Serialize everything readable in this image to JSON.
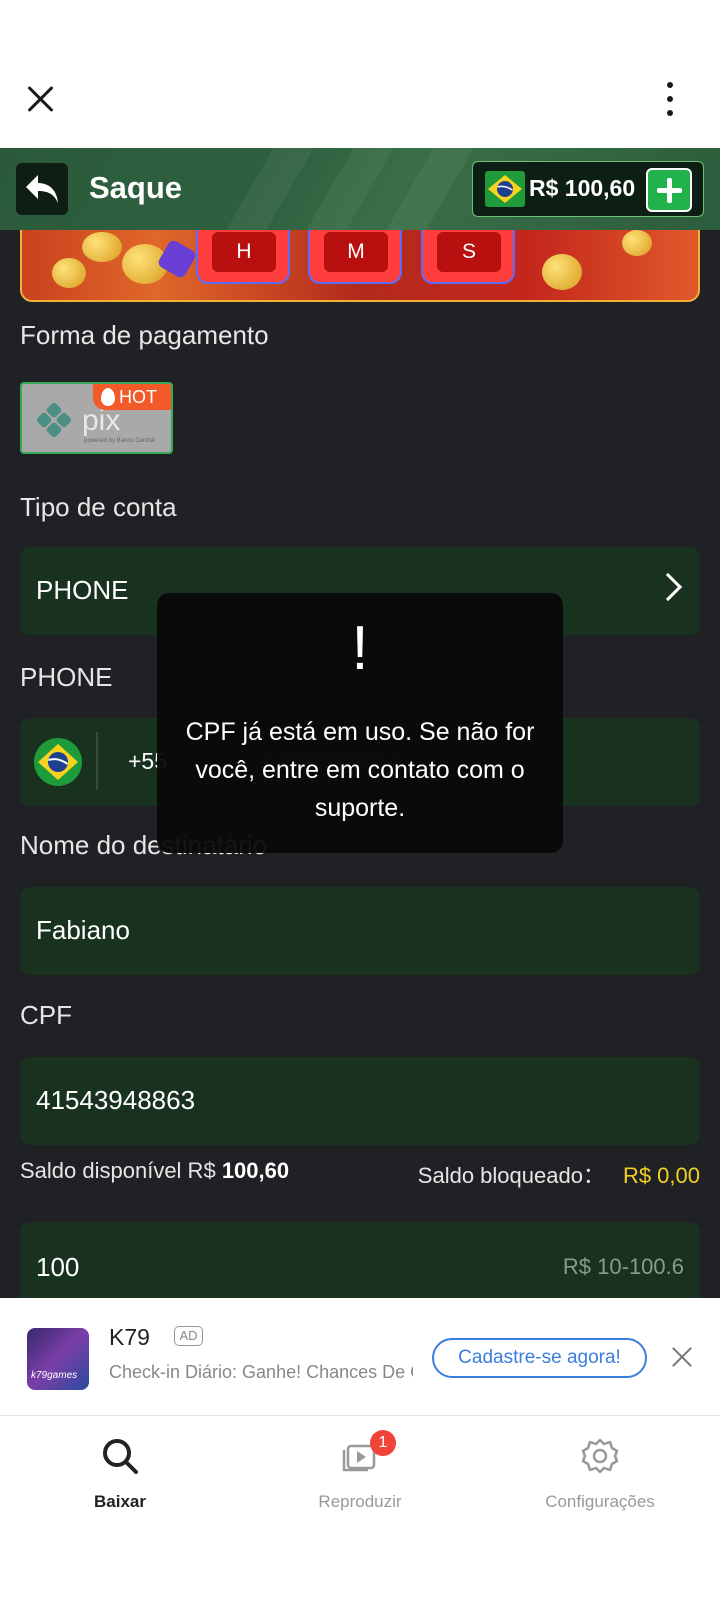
{
  "header": {
    "title": "Saque",
    "balance": "R$ 100,60"
  },
  "banner": {
    "timer_labels": [
      "H",
      "M",
      "S"
    ]
  },
  "payment": {
    "label": "Forma de pagamento",
    "method_logo": "PIX",
    "badge": "HOT"
  },
  "account_type": {
    "label": "Tipo de conta",
    "value": "PHONE"
  },
  "phone": {
    "label": "PHONE",
    "prefix": "+55",
    "value": "17997769644"
  },
  "recipient": {
    "label": "Nome do destinatário",
    "value": "Fabiano"
  },
  "cpf": {
    "label": "CPF",
    "value": "41543948863"
  },
  "saldo": {
    "available_label": "Saldo disponível R$",
    "available_value": "100,60",
    "blocked_label": "Saldo bloqueado：",
    "blocked_value": "R$ 0,00"
  },
  "amount": {
    "value": "100",
    "range": "R$ 10-100.6"
  },
  "toast": {
    "mark": "!",
    "message": "CPF já está em uso. Se não for você, entre em contato com o suporte."
  },
  "ad": {
    "app_name": "K79",
    "tag": "AD",
    "icon_text": "k79games",
    "description": "Check-in Diário: Ganhe! Chances De Ganhar",
    "cta": "Cadastre-se agora!"
  },
  "nav": {
    "items": [
      {
        "label": "Baixar",
        "icon": "search-icon",
        "active": true
      },
      {
        "label": "Reproduzir",
        "icon": "play-icon",
        "badge": "1"
      },
      {
        "label": "Configurações",
        "icon": "gear-icon"
      }
    ]
  },
  "colors": {
    "header_green": "#2f6140",
    "field_green": "#18321f",
    "page_bg": "#1f2124",
    "accent_yellow": "#f2d024",
    "cta_blue": "#3b7ddd"
  }
}
